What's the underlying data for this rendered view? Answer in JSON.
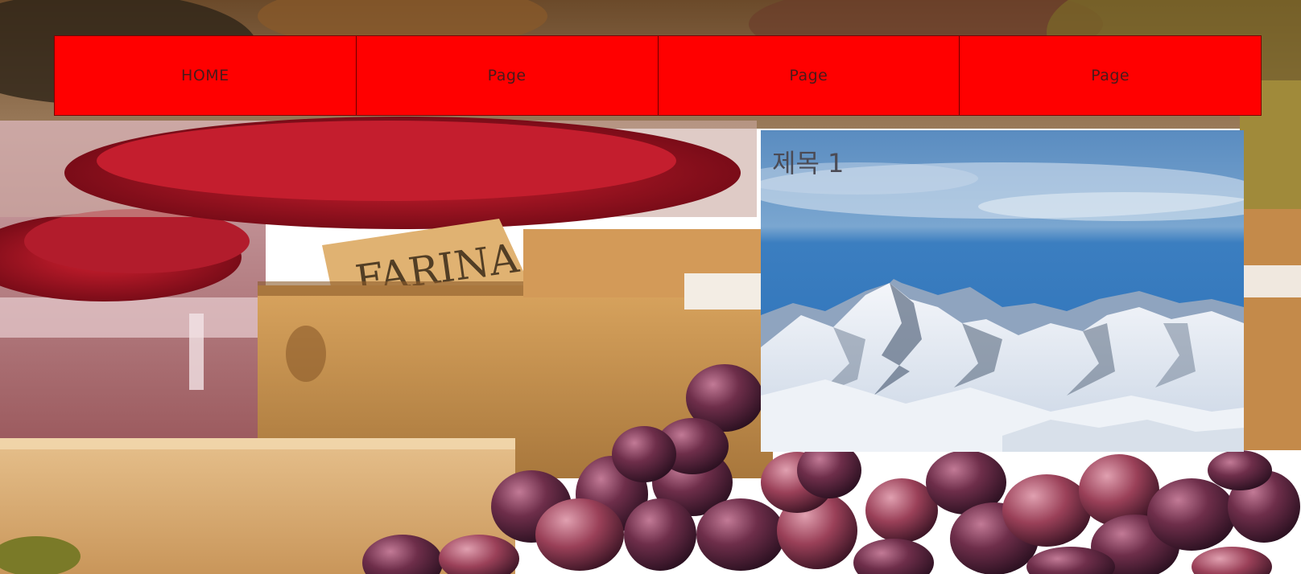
{
  "nav": {
    "items": [
      {
        "label": "HOME"
      },
      {
        "label": "Page"
      },
      {
        "label": "Page"
      },
      {
        "label": "Page"
      }
    ],
    "color": "#ff0000"
  },
  "card": {
    "title": "제목 1"
  },
  "background": {
    "description_icon": "market-produce-image"
  },
  "card_image": {
    "icon": "snowy-mountains-image"
  }
}
